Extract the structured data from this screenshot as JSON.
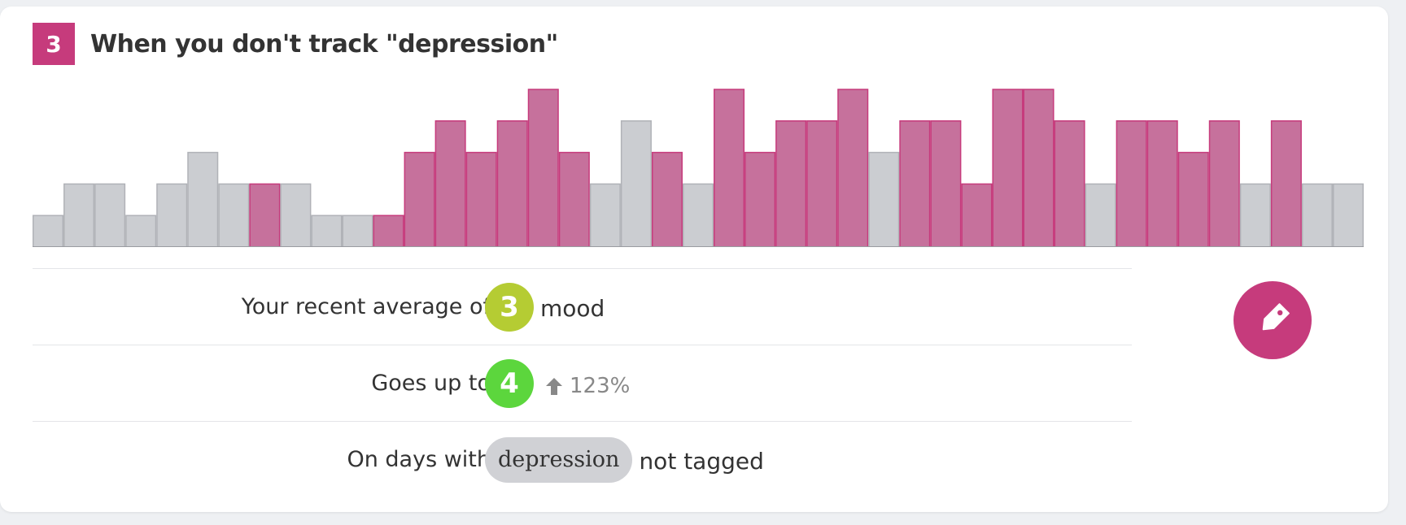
{
  "card": {
    "rank": "3",
    "title": "When you don't track \"depression\""
  },
  "colors": {
    "highlight": "#c6719c",
    "highlight_stroke": "#c63b7c",
    "neutral": "#cbcdd1",
    "neutral_stroke": "#b0b2b7",
    "accent": "#c63b7c",
    "avg_circle": "#b5cc33",
    "up_circle": "#5cd63d"
  },
  "chart_data": {
    "type": "bar",
    "ylim": [
      0,
      5
    ],
    "values": [
      1,
      2,
      2,
      1,
      2,
      3,
      2,
      2,
      2,
      1,
      1,
      1,
      3,
      4,
      3,
      4,
      5,
      3,
      2,
      4,
      3,
      2,
      5,
      3,
      4,
      4,
      5,
      3,
      4,
      4,
      2,
      5,
      5,
      4,
      2,
      4,
      4,
      3,
      4,
      2,
      4,
      2,
      2
    ],
    "highlighted": [
      false,
      false,
      false,
      false,
      false,
      false,
      false,
      true,
      false,
      false,
      false,
      true,
      true,
      true,
      true,
      true,
      true,
      true,
      false,
      false,
      true,
      false,
      true,
      true,
      true,
      true,
      true,
      false,
      true,
      true,
      true,
      true,
      true,
      true,
      false,
      true,
      true,
      true,
      true,
      false,
      true,
      false,
      false
    ]
  },
  "stats": {
    "average": {
      "label": "Your recent average of",
      "score": "3",
      "unit": "mood"
    },
    "goes_up": {
      "label": "Goes up to",
      "score": "4",
      "change": "123%"
    },
    "condition": {
      "label": "On days with",
      "tag": "depression",
      "suffix": "not tagged"
    }
  },
  "actions": {
    "tag_button_icon": "tag-icon"
  }
}
